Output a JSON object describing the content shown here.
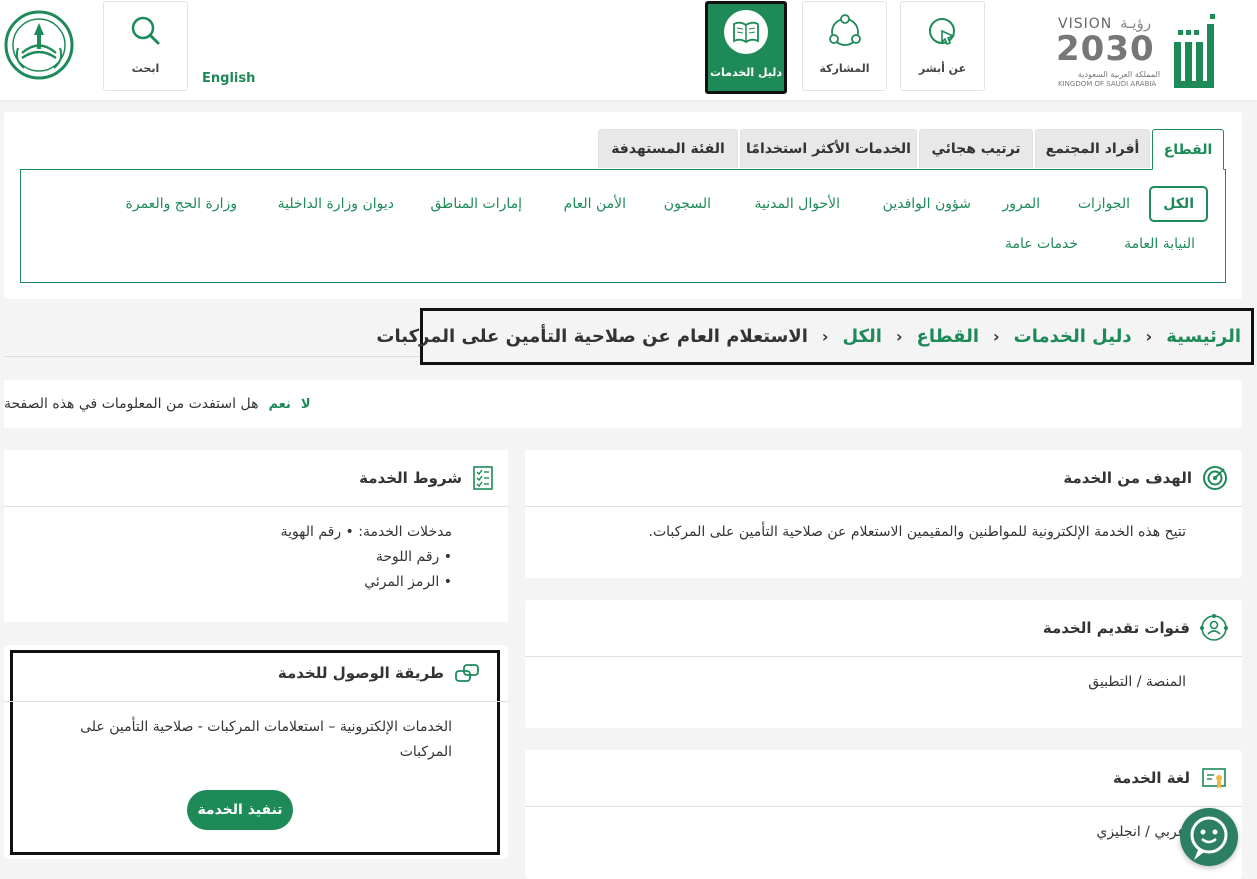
{
  "header": {
    "tiles": {
      "search": "ابحث",
      "guide": "دليل الخدمات",
      "participation": "المشاركة",
      "about": "عن أبشر"
    },
    "english": "English",
    "vision": {
      "word": "VISION",
      "arabic": "رؤيـة",
      "year": "2030",
      "country_ar": "المملكة العربية السعودية",
      "country_en": "KINGDOM OF SAUDI ARABIA"
    },
    "absher_logo": "أبشر"
  },
  "tabs": [
    "القطاع",
    "أفراد المجتمع",
    "ترتيب هجائي",
    "الخدمات الأكثر استخدامًا",
    "الفئة المستهدفة"
  ],
  "categories": {
    "row1": [
      "الكل",
      "الجوازات",
      "المرور",
      "شؤون الوافدين",
      "الأحوال المدنية",
      "السجون",
      "الأمن العام",
      "إمارات المناطق",
      "ديوان وزارة الداخلية",
      "وزارة الحج والعمرة"
    ],
    "row2": [
      "النيابة العامة",
      "خدمات عامة"
    ]
  },
  "breadcrumb": {
    "items": [
      "الرئيسية",
      "دليل الخدمات",
      "القطاع",
      "الكل"
    ],
    "current": "الاستعلام العام عن صلاحية التأمين على المركبات",
    "sep": "›"
  },
  "feedback": {
    "question": "هل استفدت من المعلومات في هذه الصفحة",
    "yes": "نعم",
    "no": "لا"
  },
  "cards": {
    "goal": {
      "title": "الهدف من الخدمة",
      "text": "تتيح هذه الخدمة الإلكترونية للمواطنين والمقيمين الاستعلام عن صلاحية التأمين على المركبات."
    },
    "channels": {
      "title": "قنوات تقديم الخدمة",
      "text": "المنصة / التطبيق"
    },
    "language": {
      "title": "لغة الخدمة",
      "text": "عربي / انجليزي"
    },
    "conditions": {
      "title": "شروط الخدمة",
      "lines": [
        "مدخلات الخدمة: • رقم الهوية",
        "• رقم اللوحة",
        "• الرمز المرئي"
      ]
    },
    "access": {
      "title": "طريقة الوصول للخدمة",
      "line1": "الخدمات الإلكترونية – استعلامات المركبات - صلاحية التأمين على",
      "line2": "المركبات",
      "button": "تنفيذ الخدمة"
    }
  },
  "colors": {
    "primary": "#1d8a58",
    "background": "#f4f4f4"
  }
}
